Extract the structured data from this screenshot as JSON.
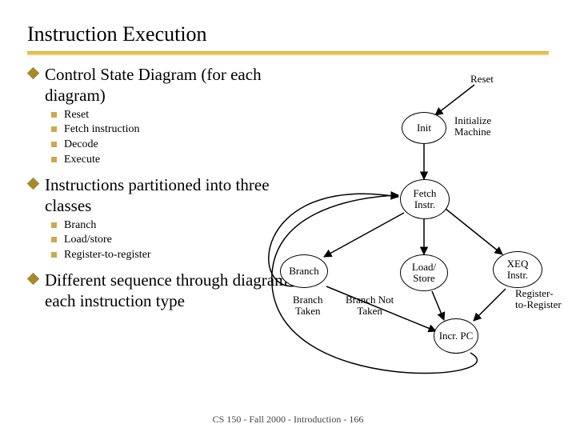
{
  "title": "Instruction Execution",
  "bullets": {
    "b1": "Control State Diagram (for each diagram)",
    "b1_items": [
      "Reset",
      "Fetch instruction",
      "Decode",
      "Execute"
    ],
    "b2": "Instructions partitioned into three classes",
    "b2_items": [
      "Branch",
      "Load/store",
      "Register-to-register"
    ],
    "b3": "Different sequence through diagram for each instruction type"
  },
  "diagram": {
    "nodes": {
      "init": "Init",
      "fetch": "Fetch Instr.",
      "branch": "Branch",
      "load": "Load/\nStore",
      "xeq": "XEQ Instr.",
      "incr": "Incr. PC"
    },
    "labels": {
      "reset": "Reset",
      "init_machine": "Initialize Machine",
      "branch_taken": "Branch Taken",
      "branch_not_taken": "Branch Not Taken",
      "reg2reg": "Register-\nto-Register"
    }
  },
  "footer": "CS 150 - Fall 2000 - Introduction - 166"
}
